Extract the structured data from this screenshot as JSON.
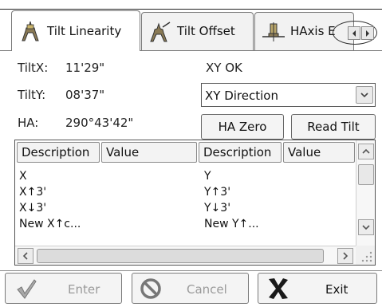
{
  "tabs": [
    {
      "label": "Tilt Linearity",
      "icon": "tilt-linearity-icon",
      "active": true
    },
    {
      "label": "Tilt Offset",
      "icon": "tilt-offset-icon",
      "active": false
    },
    {
      "label": "HAxis E",
      "icon": "haxis-icon",
      "active": false
    }
  ],
  "info": {
    "tiltx_label": "TiltX:",
    "tiltx_value": "11'29\"",
    "tilty_label": "TiltY:",
    "tilty_value": "08'37\"",
    "ha_label": "HA:",
    "ha_value": "290°43'42\"",
    "status": "XY OK"
  },
  "direction_select": {
    "value": "XY Direction"
  },
  "buttons": {
    "ha_zero": "HA Zero",
    "read_tilt": "Read Tilt"
  },
  "table": {
    "headers": [
      "Description",
      "Value",
      "Description",
      "Value"
    ],
    "rows": [
      [
        "X",
        "",
        "Y",
        ""
      ],
      [
        "X↑3'",
        "",
        "Y↑3'",
        ""
      ],
      [
        "X↓3'",
        "",
        "Y↓3'",
        ""
      ],
      [
        "New X↑c...",
        "",
        "New Y↑...",
        ""
      ]
    ]
  },
  "actions": {
    "enter": "Enter",
    "cancel": "Cancel",
    "exit": "Exit"
  },
  "colors": {
    "exit_icon": "#1a1a1a",
    "enter_icon": "#9a9a9a",
    "cancel_icon": "#8a8a8a"
  }
}
